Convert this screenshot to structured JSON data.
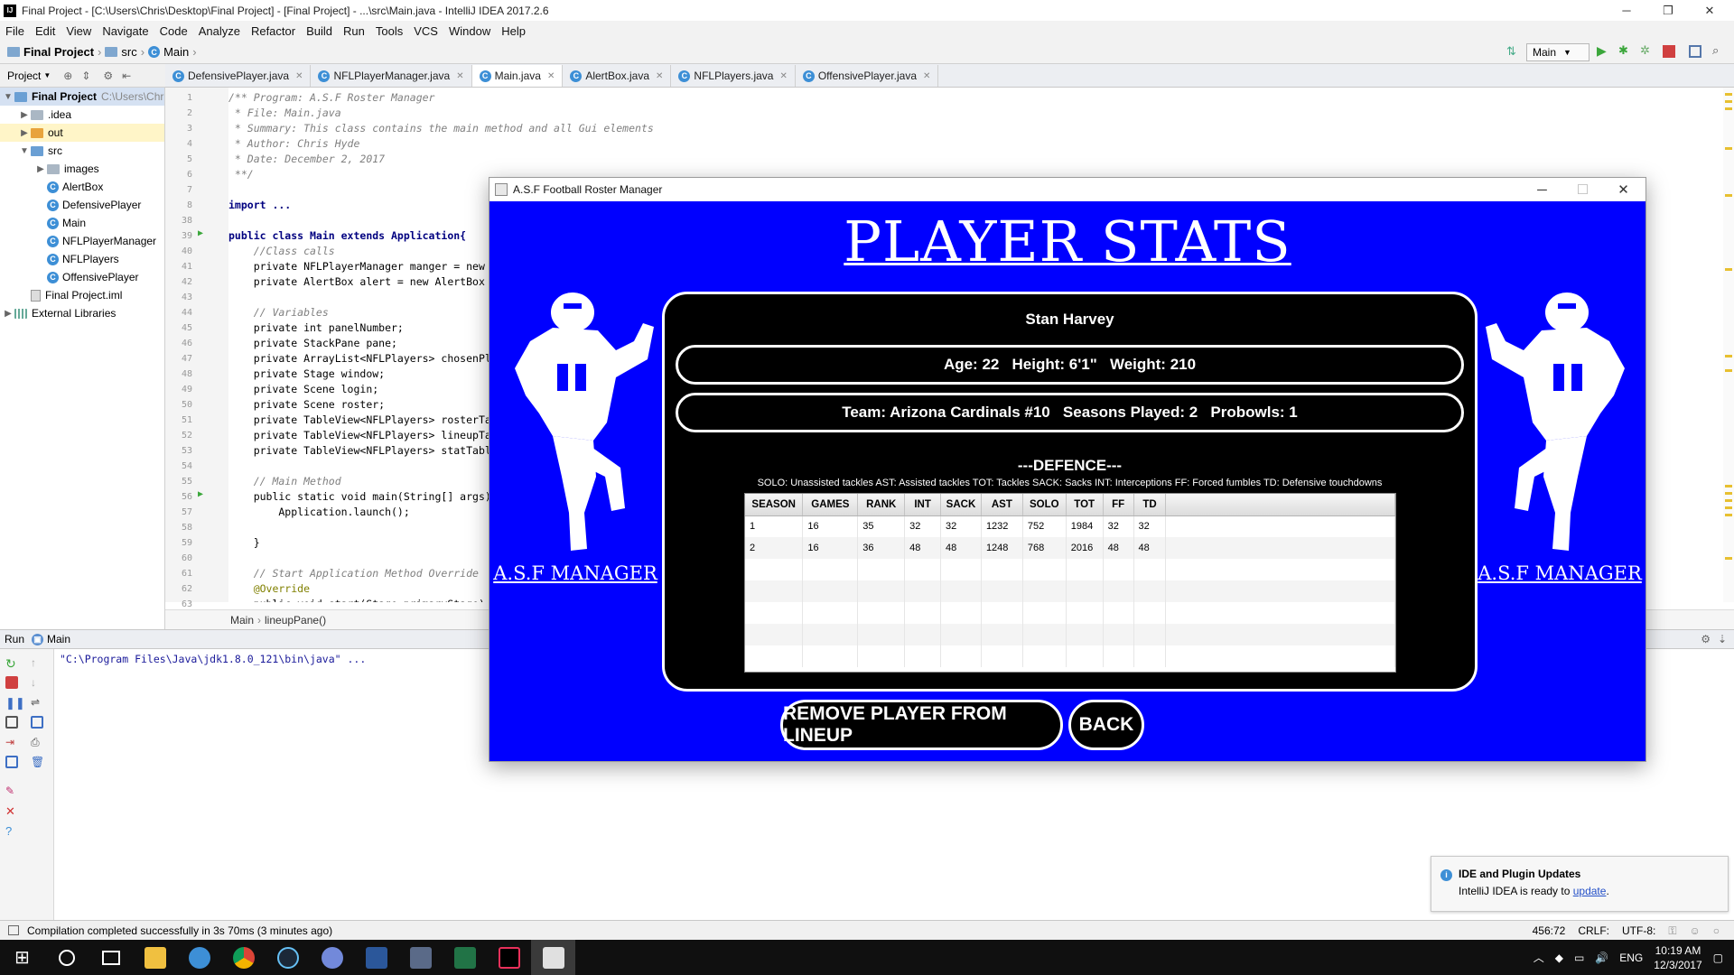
{
  "ide": {
    "window_title": "Final Project - [C:\\Users\\Chris\\Desktop\\Final Project] - [Final Project] - ...\\src\\Main.java - IntelliJ IDEA 2017.2.6",
    "menu": [
      "File",
      "Edit",
      "View",
      "Navigate",
      "Code",
      "Analyze",
      "Refactor",
      "Build",
      "Run",
      "Tools",
      "VCS",
      "Window",
      "Help"
    ],
    "breadcrumb": {
      "project": "Final Project",
      "folder": "src",
      "file": "Main"
    },
    "run_config": "Main",
    "project_panel_title": "Project",
    "tree": [
      {
        "label": "Final Project",
        "hint": "C:\\Users\\Chr",
        "indent": 0,
        "arrow": "▼",
        "icon": "folder-blue",
        "bold": true,
        "selected": true
      },
      {
        "label": ".idea",
        "indent": 1,
        "arrow": "▶",
        "icon": "folder"
      },
      {
        "label": "out",
        "indent": 1,
        "arrow": "▶",
        "icon": "folder-orange",
        "highlight": true
      },
      {
        "label": "src",
        "indent": 1,
        "arrow": "▼",
        "icon": "folder-blue"
      },
      {
        "label": "images",
        "indent": 2,
        "arrow": "▶",
        "icon": "folder"
      },
      {
        "label": "AlertBox",
        "indent": 2,
        "arrow": "",
        "icon": "class"
      },
      {
        "label": "DefensivePlayer",
        "indent": 2,
        "arrow": "",
        "icon": "class"
      },
      {
        "label": "Main",
        "indent": 2,
        "arrow": "",
        "icon": "class"
      },
      {
        "label": "NFLPlayerManager",
        "indent": 2,
        "arrow": "",
        "icon": "class"
      },
      {
        "label": "NFLPlayers",
        "indent": 2,
        "arrow": "",
        "icon": "class"
      },
      {
        "label": "OffensivePlayer",
        "indent": 2,
        "arrow": "",
        "icon": "class"
      },
      {
        "label": "Final Project.iml",
        "indent": 1,
        "arrow": "",
        "icon": "file"
      },
      {
        "label": "External Libraries",
        "indent": 0,
        "arrow": "▶",
        "icon": "library"
      }
    ],
    "tabs": [
      {
        "label": "DefensivePlayer.java",
        "active": false
      },
      {
        "label": "NFLPlayerManager.java",
        "active": false
      },
      {
        "label": "Main.java",
        "active": true
      },
      {
        "label": "AlertBox.java",
        "active": false
      },
      {
        "label": "NFLPlayers.java",
        "active": false
      },
      {
        "label": "OffensivePlayer.java",
        "active": false
      }
    ],
    "code_lines": [
      {
        "n": "1",
        "t": "/** Program: A.S.F Roster Manager",
        "c": "cm"
      },
      {
        "n": "2",
        "t": " * File: Main.java",
        "c": "cm"
      },
      {
        "n": "3",
        "t": " * Summary: This class contains the main method and all Gui elements",
        "c": "cm"
      },
      {
        "n": "4",
        "t": " * Author: Chris Hyde",
        "c": "cm"
      },
      {
        "n": "5",
        "t": " * Date: December 2, 2017",
        "c": "cm"
      },
      {
        "n": "6",
        "t": " **/",
        "c": "cm"
      },
      {
        "n": "7",
        "t": "",
        "c": ""
      },
      {
        "n": "8",
        "t": "import ...",
        "c": "kw"
      },
      {
        "n": "38",
        "t": "",
        "c": ""
      },
      {
        "n": "39",
        "t": "public class Main extends Application{",
        "c": "kw"
      },
      {
        "n": "40",
        "t": "    //Class calls",
        "c": "cm"
      },
      {
        "n": "41",
        "t": "    private NFLPlayerManager manger = new",
        "c": ""
      },
      {
        "n": "42",
        "t": "    private AlertBox alert = new AlertBox",
        "c": ""
      },
      {
        "n": "43",
        "t": "",
        "c": ""
      },
      {
        "n": "44",
        "t": "    // Variables",
        "c": "cm"
      },
      {
        "n": "45",
        "t": "    private int panelNumber;",
        "c": ""
      },
      {
        "n": "46",
        "t": "    private StackPane pane;",
        "c": ""
      },
      {
        "n": "47",
        "t": "    private ArrayList<NFLPlayers> chosenPl",
        "c": ""
      },
      {
        "n": "48",
        "t": "    private Stage window;",
        "c": ""
      },
      {
        "n": "49",
        "t": "    private Scene login;",
        "c": ""
      },
      {
        "n": "50",
        "t": "    private Scene roster;",
        "c": ""
      },
      {
        "n": "51",
        "t": "    private TableView<NFLPlayers> rosterTa",
        "c": ""
      },
      {
        "n": "52",
        "t": "    private TableView<NFLPlayers> lineupTa",
        "c": ""
      },
      {
        "n": "53",
        "t": "    private TableView<NFLPlayers> statTabl",
        "c": ""
      },
      {
        "n": "54",
        "t": "",
        "c": ""
      },
      {
        "n": "55",
        "t": "    // Main Method",
        "c": "cm"
      },
      {
        "n": "56",
        "t": "    public static void main(String[] args)",
        "c": ""
      },
      {
        "n": "57",
        "t": "        Application.launch();",
        "c": ""
      },
      {
        "n": "58",
        "t": "",
        "c": ""
      },
      {
        "n": "59",
        "t": "    }",
        "c": ""
      },
      {
        "n": "60",
        "t": "",
        "c": ""
      },
      {
        "n": "61",
        "t": "    // Start Application Method Override",
        "c": "cm"
      },
      {
        "n": "62",
        "t": "    @Override",
        "c": "an"
      },
      {
        "n": "63",
        "t": "    public void start(Stage primaryStage)",
        "c": ""
      }
    ],
    "editor_breadcrumb": [
      "Main",
      "lineupPane()"
    ],
    "run_tab": "Run",
    "run_config_tab": "Main",
    "console_line": "\"C:\\Program Files\\Java\\jdk1.8.0_121\\bin\\java\" ...",
    "status_message": "Compilation completed successfully in 3s 70ms (3 minutes ago)",
    "status_right": {
      "position": "456:72",
      "line_sep": "CRLF:",
      "encoding": "UTF-8:"
    },
    "notification": {
      "title": "IDE and Plugin Updates",
      "body": "IntelliJ IDEA is ready to ",
      "link": "update",
      "tail": "."
    }
  },
  "app": {
    "window_title": "A.S.F Football Roster Manager",
    "heading": "PLAYER STATS",
    "side_label": "A.S.F MANAGER",
    "player_name": "Stan Harvey",
    "bio_line": "Age: 22   Height: 6'1\"   Weight: 210",
    "team_line": "Team: Arizona Cardinals #10   Seasons Played: 2   Probowls: 1",
    "section_title": "---DEFENCE---",
    "legend": "SOLO: Unassisted tackles AST: Assisted tackles TOT: Tackles SACK: Sacks INT: Interceptions FF: Forced fumbles TD: Defensive touchdowns",
    "stat_columns": [
      "SEASON",
      "GAMES",
      "RANK",
      "INT",
      "SACK",
      "AST",
      "SOLO",
      "TOT",
      "FF",
      "TD"
    ],
    "stat_rows": [
      [
        "1",
        "16",
        "35",
        "32",
        "32",
        "1232",
        "752",
        "1984",
        "32",
        "32"
      ],
      [
        "2",
        "16",
        "36",
        "48",
        "48",
        "1248",
        "768",
        "2016",
        "48",
        "48"
      ]
    ],
    "remove_button": "REMOVE PLAYER FROM LINEUP",
    "back_button": "BACK",
    "colors": {
      "background": "#0000ff",
      "card": "#000000",
      "text": "#ffffff"
    }
  },
  "taskbar": {
    "time": "10:19 AM",
    "date": "12/3/2017",
    "language": "ENG"
  }
}
